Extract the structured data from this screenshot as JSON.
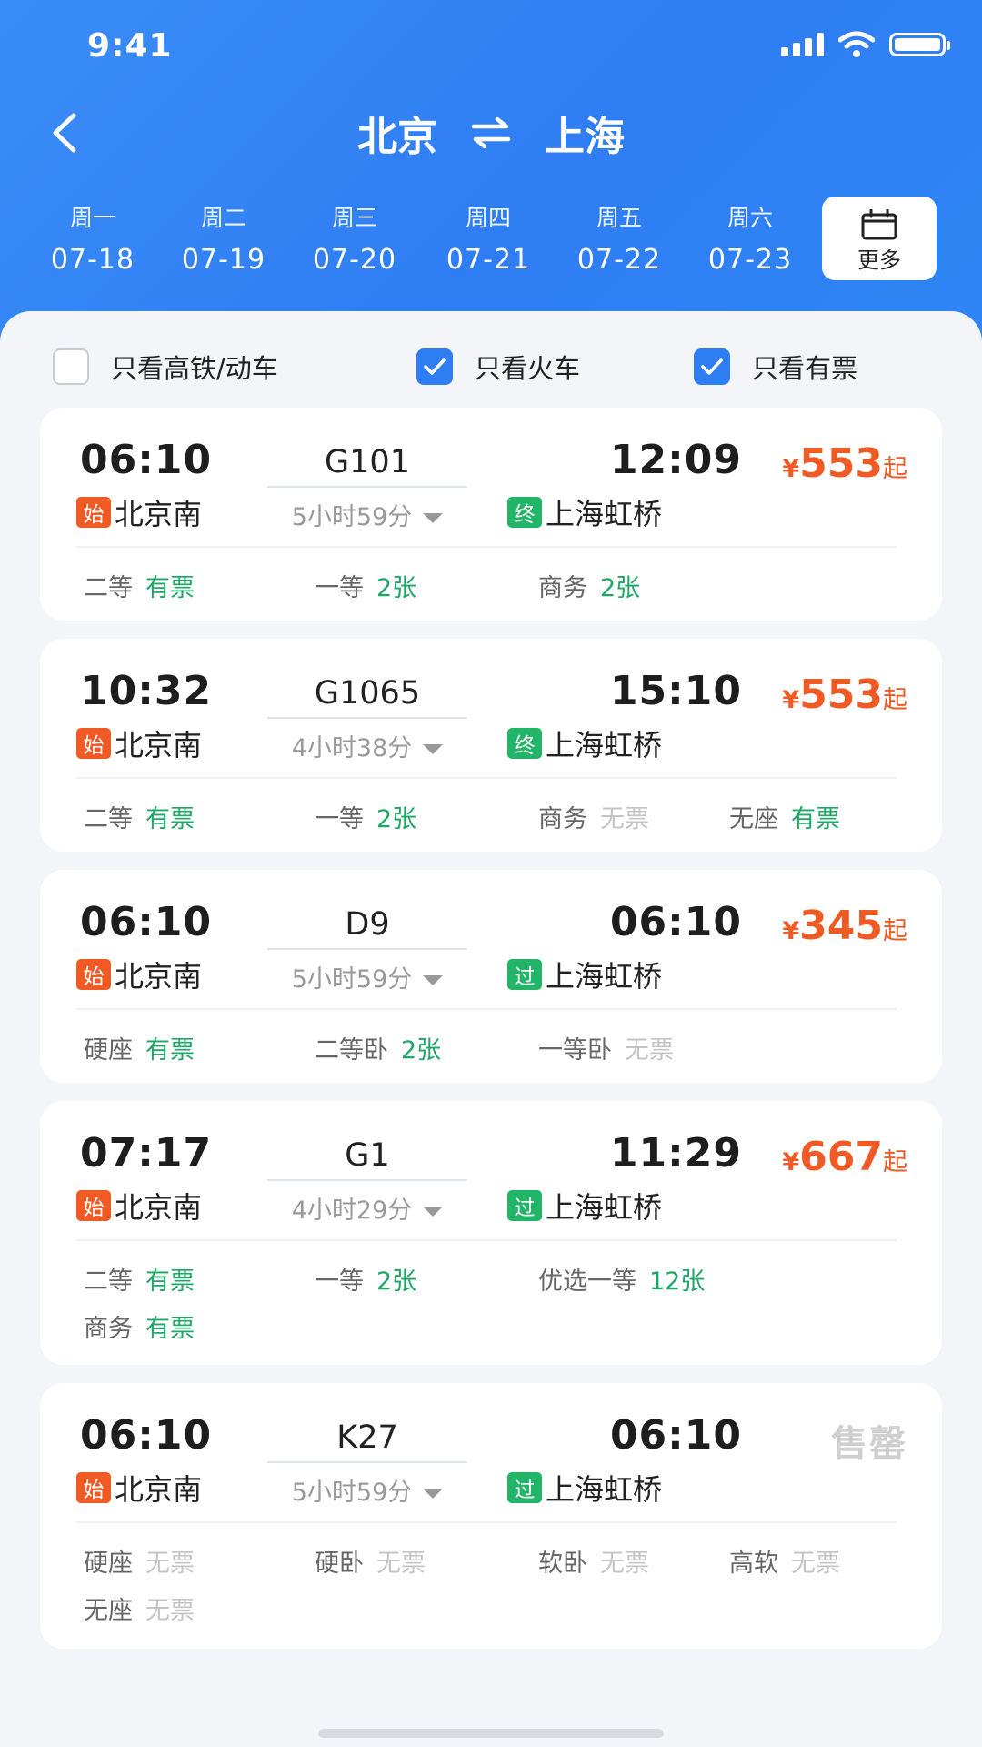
{
  "status_bar": {
    "time": "9:41"
  },
  "nav": {
    "from": "北京",
    "to": "上海"
  },
  "dates": [
    {
      "weekday": "周一",
      "date": "07-18"
    },
    {
      "weekday": "周二",
      "date": "07-19"
    },
    {
      "weekday": "周三",
      "date": "07-20"
    },
    {
      "weekday": "周四",
      "date": "07-21"
    },
    {
      "weekday": "周五",
      "date": "07-22"
    },
    {
      "weekday": "周六",
      "date": "07-23"
    }
  ],
  "more_label": "更多",
  "filters": [
    {
      "label": "只看高铁/动车",
      "checked": false
    },
    {
      "label": "只看火车",
      "checked": true
    },
    {
      "label": "只看有票",
      "checked": true
    }
  ],
  "colors": {
    "brand_blue": "#2f7df3",
    "price_orange": "#f05a24",
    "available_green": "#1ea766",
    "station_mid_green": "#22b467"
  },
  "trains": [
    {
      "dep_time": "06:10",
      "train_no": "G101",
      "arr_time": "12:09",
      "dep_tag": "始",
      "dep_station": "北京南",
      "duration": "5小时59分",
      "arr_tag": "终",
      "arr_station": "上海虹桥",
      "price_currency": "¥",
      "price_value": "553",
      "price_suffix": "起",
      "soldout_label": "",
      "seats": [
        {
          "type": "二等",
          "status": "有票"
        },
        {
          "type": "一等",
          "status": "2张"
        },
        {
          "type": "商务",
          "status": "2张"
        }
      ]
    },
    {
      "dep_time": "10:32",
      "train_no": "G1065",
      "arr_time": "15:10",
      "dep_tag": "始",
      "dep_station": "北京南",
      "duration": "4小时38分",
      "arr_tag": "终",
      "arr_station": "上海虹桥",
      "price_currency": "¥",
      "price_value": "553",
      "price_suffix": "起",
      "soldout_label": "",
      "seats": [
        {
          "type": "二等",
          "status": "有票"
        },
        {
          "type": "一等",
          "status": "2张"
        },
        {
          "type": "商务",
          "status": "无票"
        },
        {
          "type": "无座",
          "status": "有票"
        }
      ]
    },
    {
      "dep_time": "06:10",
      "train_no": "D9",
      "arr_time": "06:10",
      "dep_tag": "始",
      "dep_station": "北京南",
      "duration": "5小时59分",
      "arr_tag": "过",
      "arr_station": "上海虹桥",
      "price_currency": "¥",
      "price_value": "345",
      "price_suffix": "起",
      "soldout_label": "",
      "seats": [
        {
          "type": "硬座",
          "status": "有票"
        },
        {
          "type": "二等卧",
          "status": "2张"
        },
        {
          "type": "一等卧",
          "status": "无票"
        }
      ]
    },
    {
      "dep_time": "07:17",
      "train_no": "G1",
      "arr_time": "11:29",
      "dep_tag": "始",
      "dep_station": "北京南",
      "duration": "4小时29分",
      "arr_tag": "过",
      "arr_station": "上海虹桥",
      "price_currency": "¥",
      "price_value": "667",
      "price_suffix": "起",
      "soldout_label": "",
      "seats": [
        {
          "type": "二等",
          "status": "有票"
        },
        {
          "type": "一等",
          "status": "2张"
        },
        {
          "type": "优选一等",
          "status": "12张"
        },
        {
          "type": "商务",
          "status": "有票"
        }
      ]
    },
    {
      "dep_time": "06:10",
      "train_no": "K27",
      "arr_time": "06:10",
      "dep_tag": "始",
      "dep_station": "北京南",
      "duration": "5小时59分",
      "arr_tag": "过",
      "arr_station": "上海虹桥",
      "price_currency": "",
      "price_value": "",
      "price_suffix": "",
      "soldout_label": "售罄",
      "seats": [
        {
          "type": "硬座",
          "status": "无票"
        },
        {
          "type": "硬卧",
          "status": "无票"
        },
        {
          "type": "软卧",
          "status": "无票"
        },
        {
          "type": "高软",
          "status": "无票"
        },
        {
          "type": "无座",
          "status": "无票"
        }
      ]
    }
  ]
}
